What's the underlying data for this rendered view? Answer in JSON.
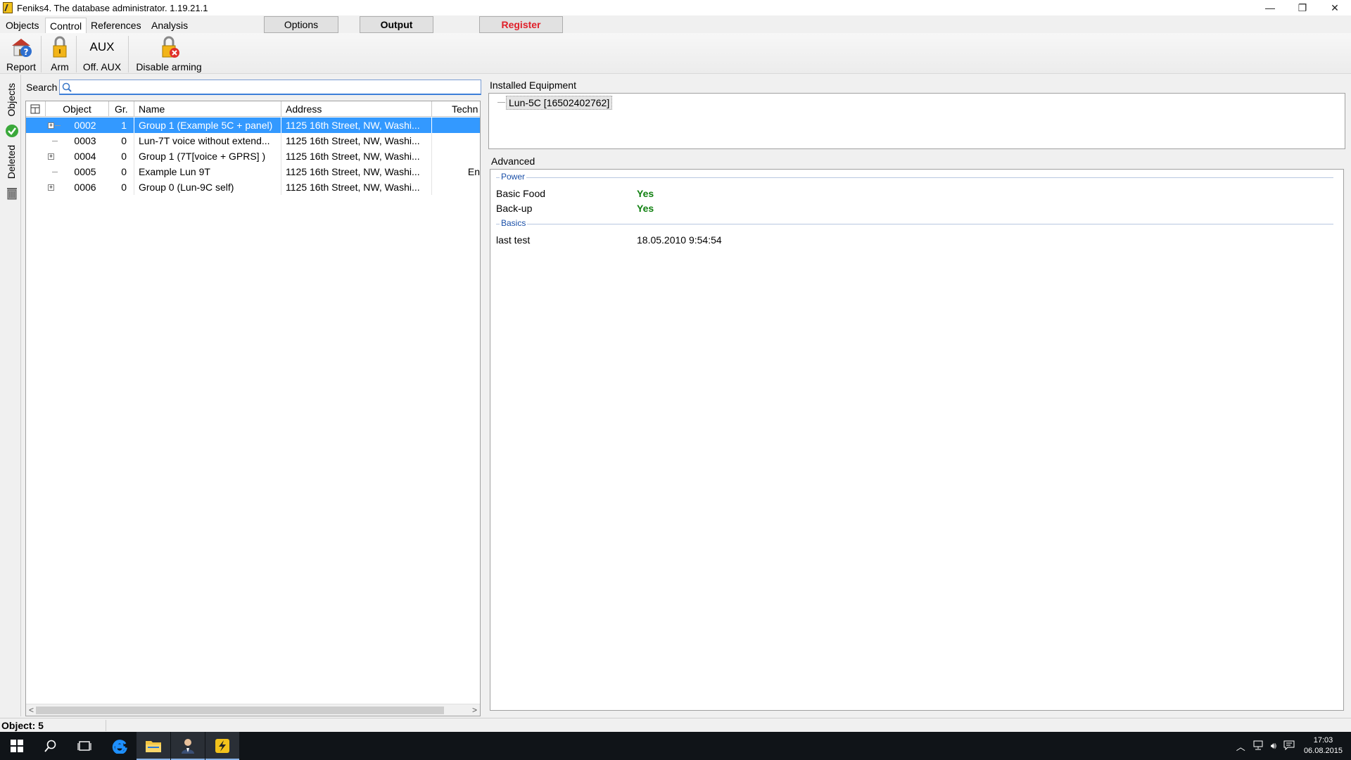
{
  "window": {
    "title": "Feniks4. The database administrator. 1.19.21.1",
    "minimize": "—",
    "restore": "❐",
    "close": "✕"
  },
  "menu": {
    "tabs": [
      "Objects",
      "Control",
      "References",
      "Analysis"
    ],
    "active_tab": "Control",
    "options_button": "Options",
    "output_button": "Output",
    "register_button": "Register"
  },
  "toolbar": {
    "report": "Report",
    "arm": "Arm",
    "aux_icon_text": "AUX",
    "off_aux": "Off. AUX",
    "disable_arming": "Disable arming"
  },
  "side_tabs": {
    "objects": "Objects",
    "deleted": "Deleted"
  },
  "search": {
    "label": "Search",
    "value": ""
  },
  "grid": {
    "columns": [
      "Object",
      "Gr.",
      "Name",
      "Address",
      "Techn"
    ],
    "rows": [
      {
        "object": "0002",
        "gr": "1",
        "name": "Group 1 (Example 5C + panel)",
        "address": "1125 16th Street, NW, Washi...",
        "techn": "",
        "expandable": true,
        "selected": true
      },
      {
        "object": "0003",
        "gr": "0",
        "name": "Lun-7T voice without extend...",
        "address": "1125 16th Street, NW, Washi...",
        "techn": "",
        "expandable": false,
        "selected": false
      },
      {
        "object": "0004",
        "gr": "0",
        "name": "Group 1 (7T[voice + GPRS] )",
        "address": "1125 16th Street, NW, Washi...",
        "techn": "",
        "expandable": true,
        "selected": false
      },
      {
        "object": "0005",
        "gr": "0",
        "name": "Example Lun 9T",
        "address": "1125 16th Street, NW, Washi...",
        "techn": "En",
        "expandable": false,
        "selected": false
      },
      {
        "object": "0006",
        "gr": "0",
        "name": "Group 0 (Lun-9C self)",
        "address": "1125 16th Street, NW, Washi...",
        "techn": "",
        "expandable": true,
        "selected": false
      }
    ]
  },
  "installed_equipment": {
    "label": "Installed Equipment",
    "item": "Lun-5C [16502402762]"
  },
  "advanced": {
    "label": "Advanced",
    "groups": [
      {
        "title": "Power",
        "props": [
          {
            "name": "Basic Food",
            "value": "Yes"
          },
          {
            "name": "Back-up",
            "value": "Yes"
          }
        ]
      },
      {
        "title": "Basics",
        "props": [
          {
            "name": "last test",
            "value": "18.05.2010 9:54:54"
          }
        ]
      }
    ]
  },
  "status": {
    "text": "Object: 5"
  },
  "taskbar": {
    "time": "17:03",
    "date": "06.08.2015"
  },
  "colors": {
    "selection": "#3399ff",
    "register": "#e0202a",
    "yes_green": "#108010",
    "group_title": "#1a4fa8"
  }
}
